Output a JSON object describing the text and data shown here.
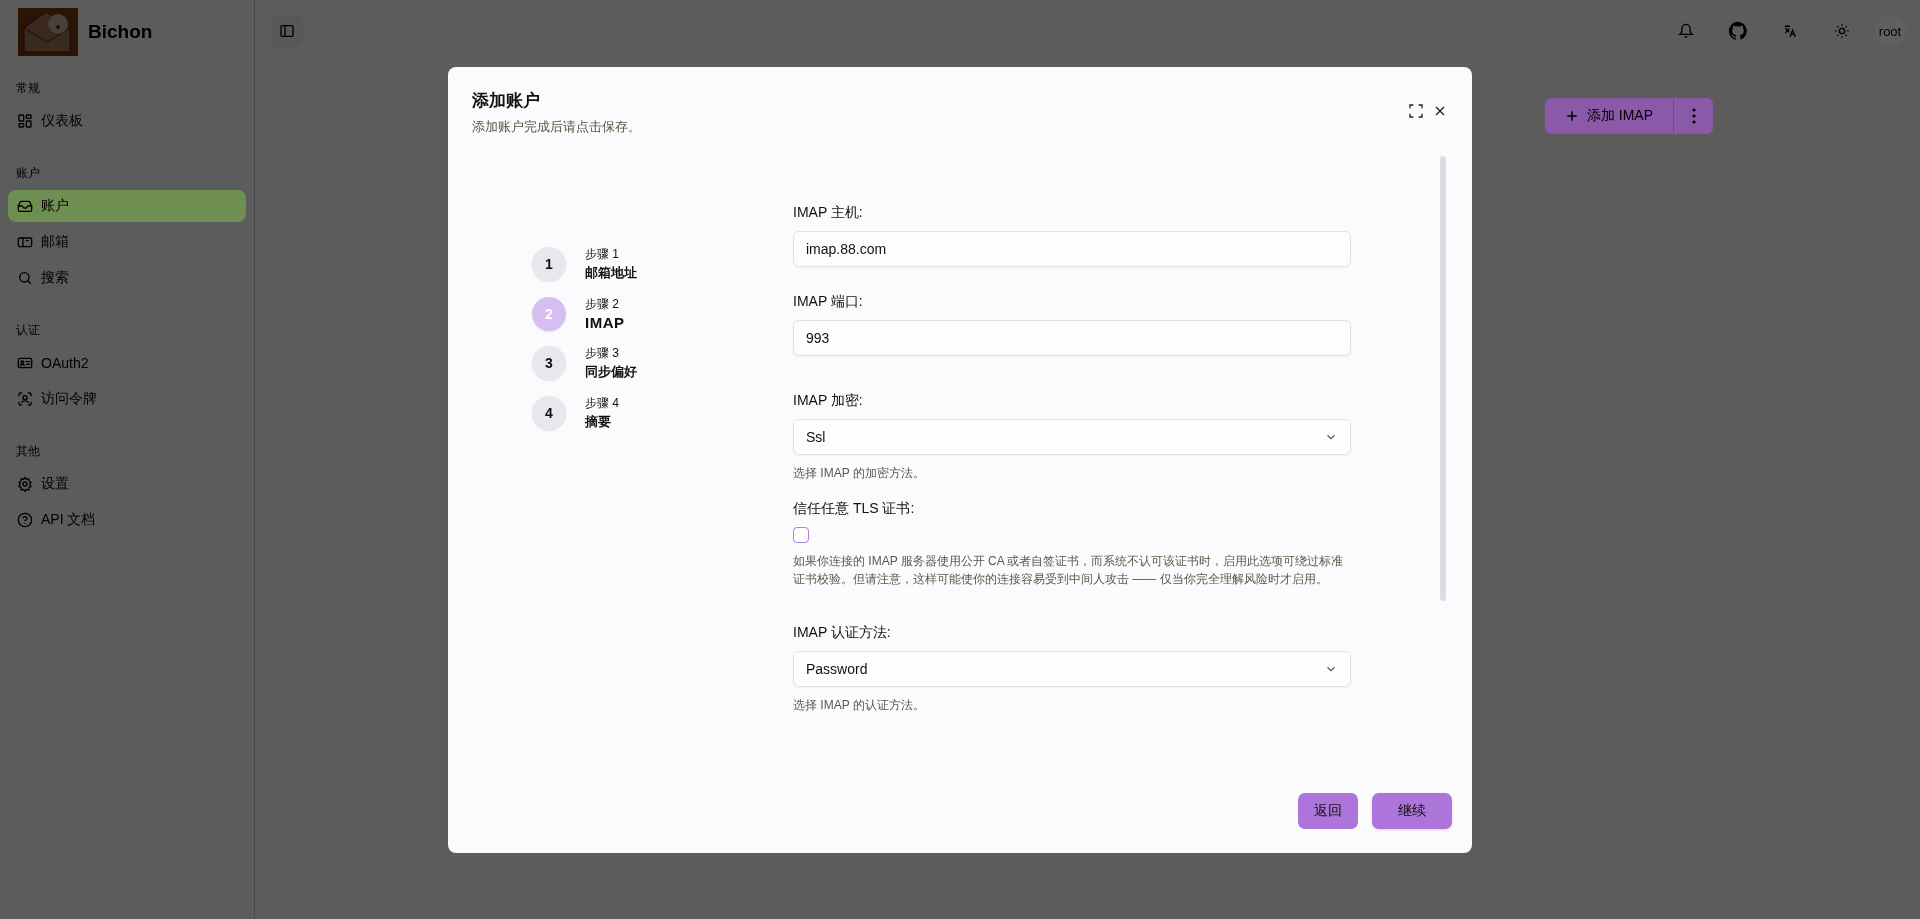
{
  "app": {
    "name": "Bichon"
  },
  "sidebar": {
    "sections": [
      {
        "title": "常规",
        "items": [
          {
            "label": "仪表板",
            "selected": false
          }
        ]
      },
      {
        "title": "账户",
        "items": [
          {
            "label": "账户",
            "selected": true
          },
          {
            "label": "邮箱",
            "selected": false
          },
          {
            "label": "搜索",
            "selected": false
          }
        ]
      },
      {
        "title": "认证",
        "items": [
          {
            "label": "OAuth2",
            "selected": false
          },
          {
            "label": "访问令牌",
            "selected": false
          }
        ]
      },
      {
        "title": "其他",
        "items": [
          {
            "label": "设置",
            "selected": false
          },
          {
            "label": "API 文档",
            "selected": false
          }
        ]
      }
    ]
  },
  "topbar": {
    "user": "root"
  },
  "page": {
    "add_button": "添加 IMAP"
  },
  "dialog": {
    "title": "添加账户",
    "subtitle": "添加账户完成后请点击保存。",
    "steps": [
      {
        "number": "1",
        "caption": "步骤 1",
        "title": "邮箱地址",
        "selected": false
      },
      {
        "number": "2",
        "caption": "步骤 2",
        "title": "IMAP",
        "selected": true
      },
      {
        "number": "3",
        "caption": "步骤 3",
        "title": "同步偏好",
        "selected": false
      },
      {
        "number": "4",
        "caption": "步骤 4",
        "title": "摘要",
        "selected": false
      }
    ],
    "fields": [
      {
        "kind": "input",
        "label": "IMAP 主机:",
        "value": "imap.88.com"
      },
      {
        "kind": "input",
        "label": "IMAP 端口:",
        "value": "993"
      },
      {
        "kind": "select",
        "label": "IMAP 加密:",
        "value": "Ssl",
        "hint": "选择 IMAP 的加密方法。"
      },
      {
        "kind": "checkbox",
        "label": "信任任意 TLS 证书:",
        "checked": false,
        "hint": "如果你连接的 IMAP 服务器使用公开 CA 或者自签证书，而系统不认可该证书时，启用此选项可绕过标准证书校验。但请注意，这样可能使你的连接容易受到中间人攻击 —— 仅当你完全理解风险时才启用。"
      },
      {
        "kind": "select",
        "label": "IMAP 认证方法:",
        "value": "Password",
        "hint": "选择 IMAP 的认证方法。"
      }
    ],
    "buttons": [
      "返回",
      "继续"
    ]
  }
}
